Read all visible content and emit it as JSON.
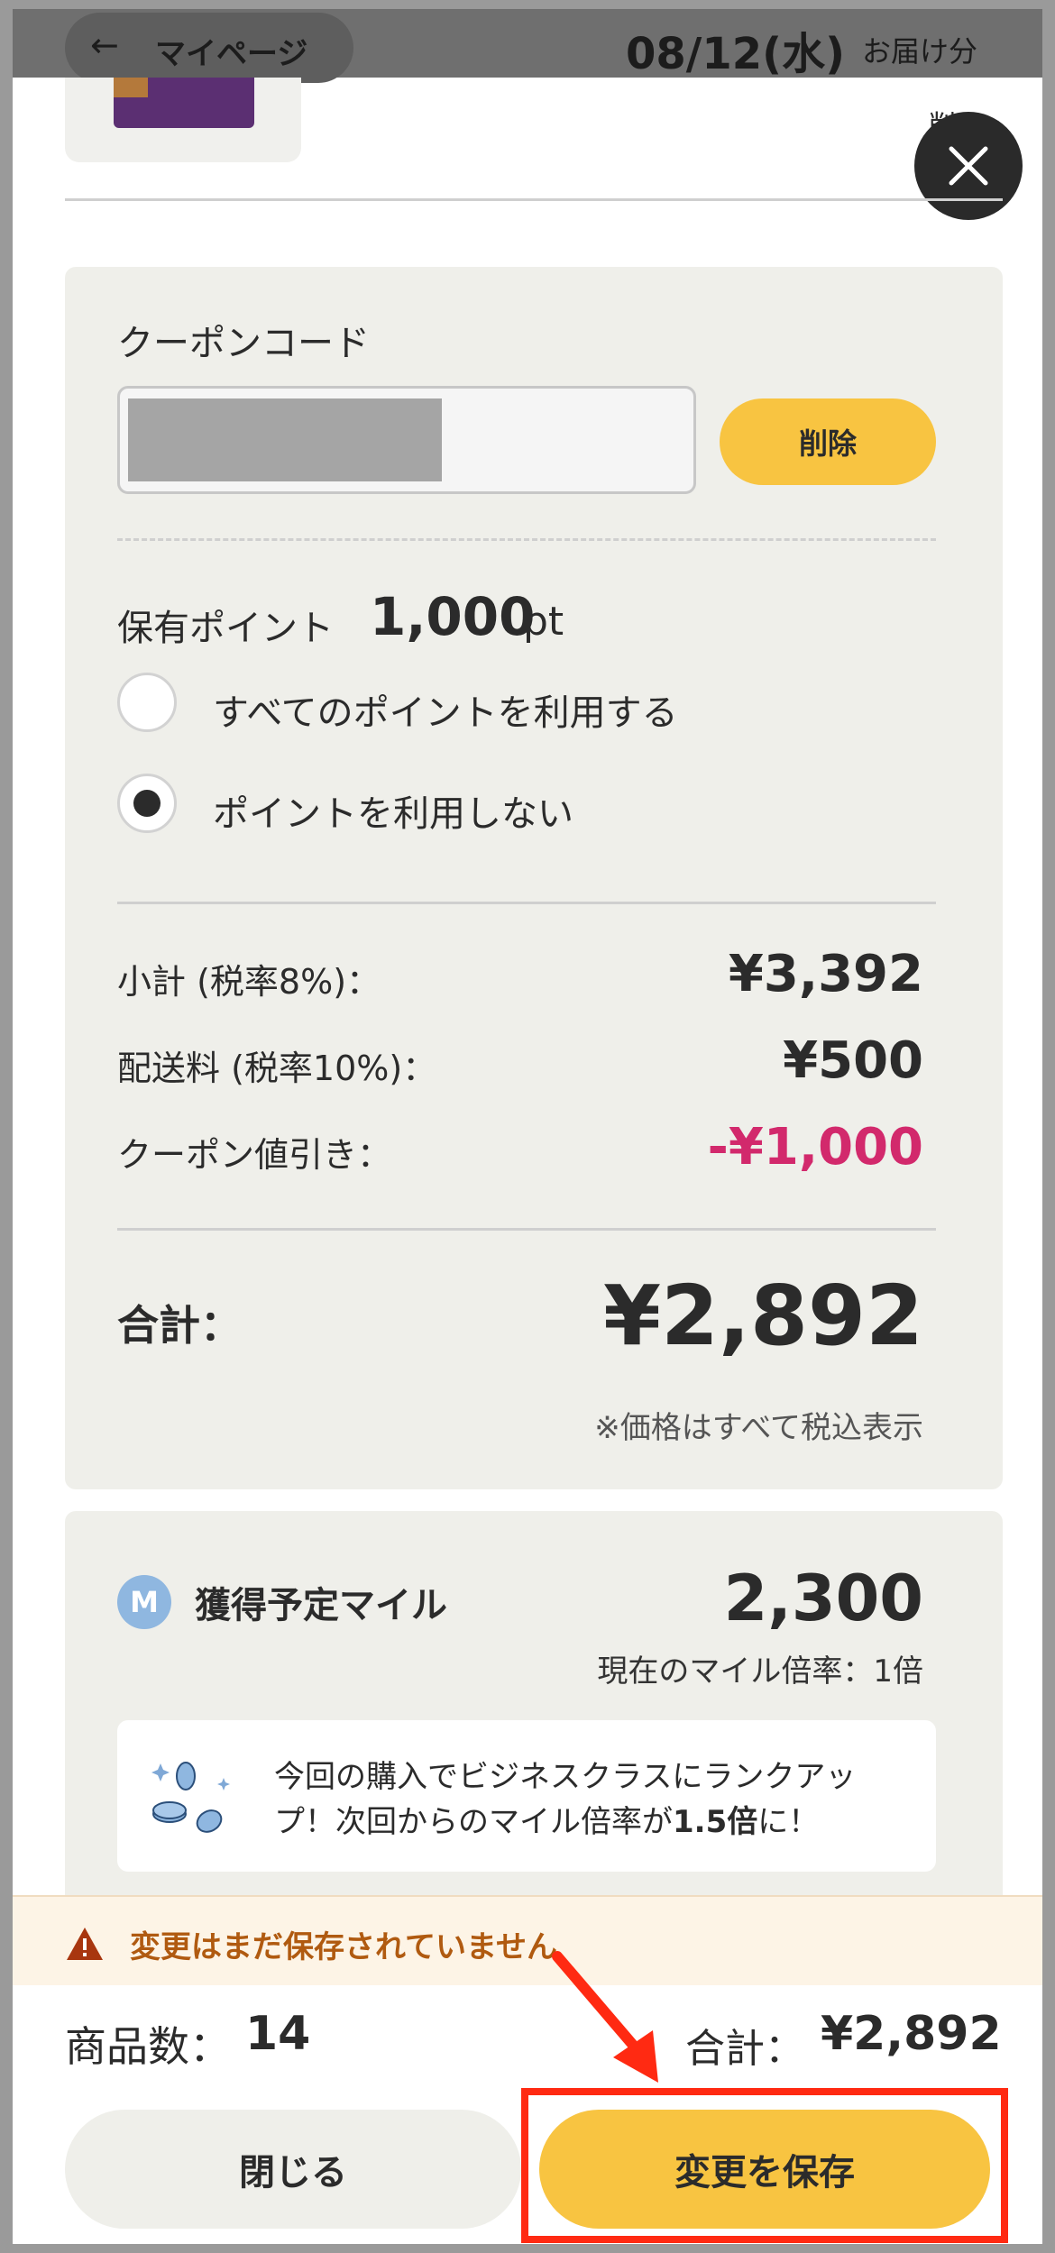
{
  "header": {
    "back_label": "マイページ",
    "date": "08/12(水)",
    "date_suffix": "お届け分"
  },
  "product_partial": {
    "side_label": "削"
  },
  "coupon": {
    "label": "クーポンコード",
    "delete_label": "削除"
  },
  "points": {
    "label": "保有ポイント",
    "value": "1,000",
    "unit": "pt",
    "options": [
      {
        "label": "すべてのポイントを利用する",
        "selected": false
      },
      {
        "label": "ポイントを利用しない",
        "selected": true
      }
    ]
  },
  "summary": {
    "subtotal_label": "小計 (税率8%)：",
    "subtotal_value": "¥3,392",
    "shipping_label": "配送料 (税率10%)：",
    "shipping_value": "¥500",
    "coupon_discount_label": "クーポン値引き：",
    "coupon_discount_value": "-¥1,000",
    "total_label": "合計：",
    "total_value": "¥2,892",
    "tax_note": "※価格はすべて税込表示"
  },
  "miles": {
    "badge": "M",
    "title": "獲得予定マイル",
    "value": "2,300",
    "rate": "現在のマイル倍率：1倍",
    "info_text_1": "今回の購入でビジネスクラスにランクアップ！次回からのマイル倍率が",
    "info_text_bold": "1.5倍",
    "info_text_2": "に！"
  },
  "banner": {
    "text": "変更はまだ保存されていません"
  },
  "bottom_bar": {
    "count_label": "商品数：",
    "count_value": "14",
    "sum_label": "合計：",
    "sum_value": "¥2,892",
    "close_label": "閉じる",
    "save_label": "変更を保存"
  },
  "colors": {
    "accent_yellow": "#f8c441",
    "discount_red": "#d2296c",
    "highlight_red": "#ff2a12",
    "mile_blue": "#8fb7e0"
  }
}
